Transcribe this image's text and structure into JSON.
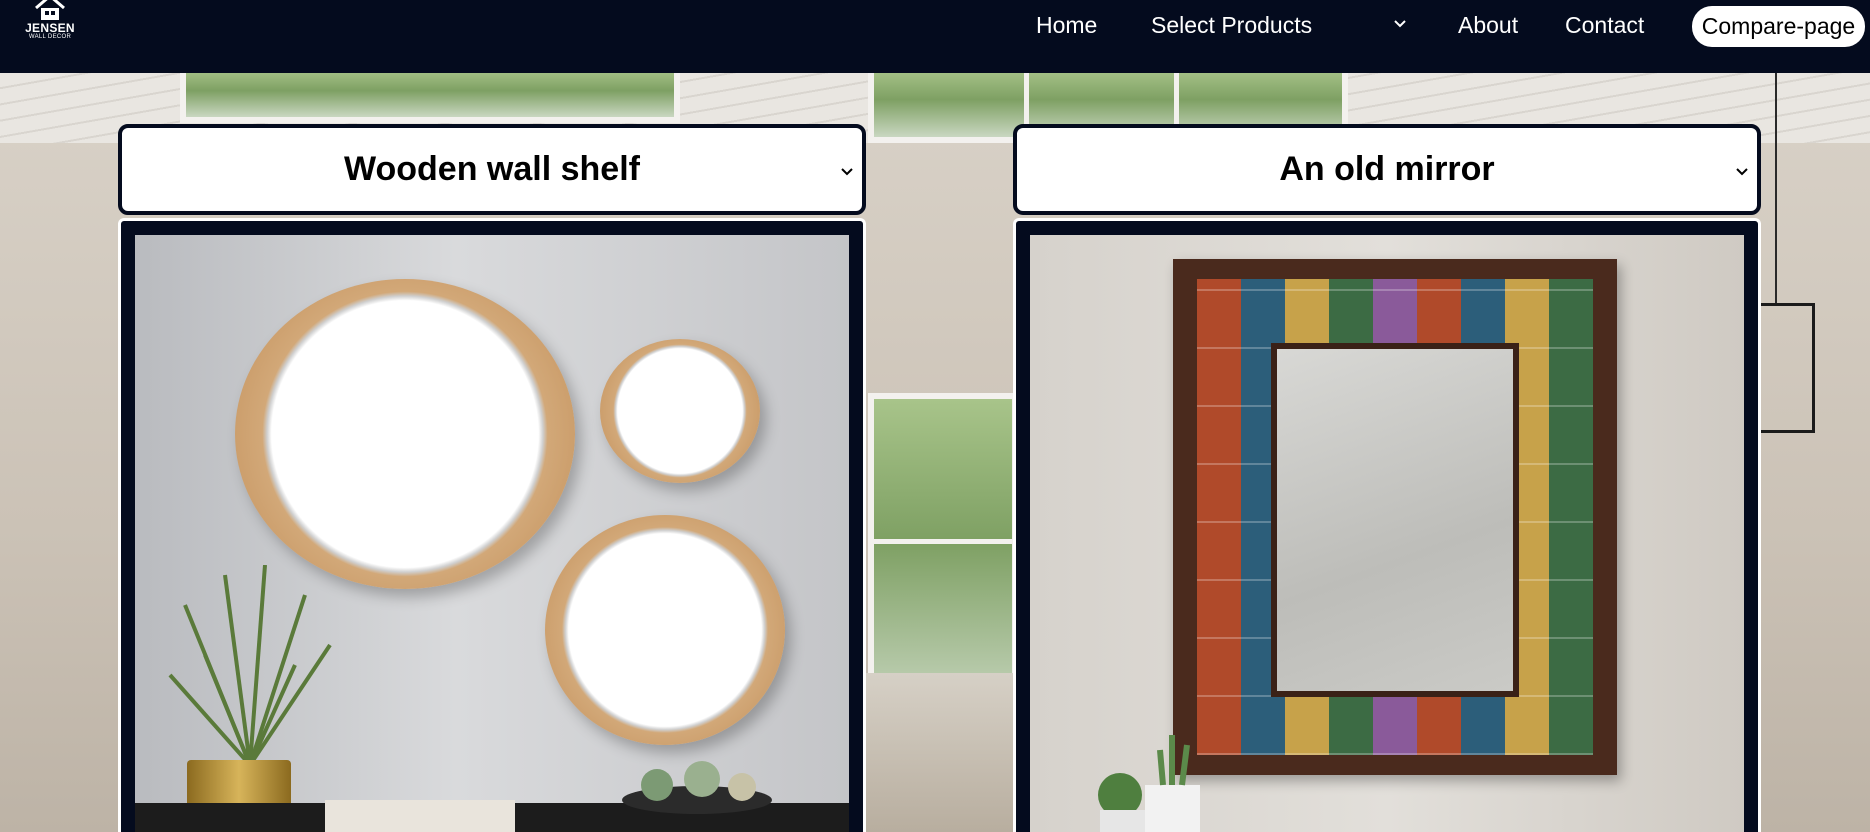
{
  "brand": {
    "name": "JENSEN",
    "tagline": "WALL DECOR"
  },
  "nav": {
    "home": "Home",
    "select_products": "Select Products",
    "about": "About",
    "contact": "Contact",
    "compare": "Compare-page"
  },
  "products": {
    "left": {
      "selected": "Wooden wall shelf"
    },
    "right": {
      "selected": "An old mirror"
    }
  },
  "colors": {
    "navbar": "#040b1e",
    "card": "#040b1e",
    "compare_button": "#ffffff"
  },
  "icons": {
    "dropdown": "chevron-down-icon",
    "logo": "house-icon"
  }
}
